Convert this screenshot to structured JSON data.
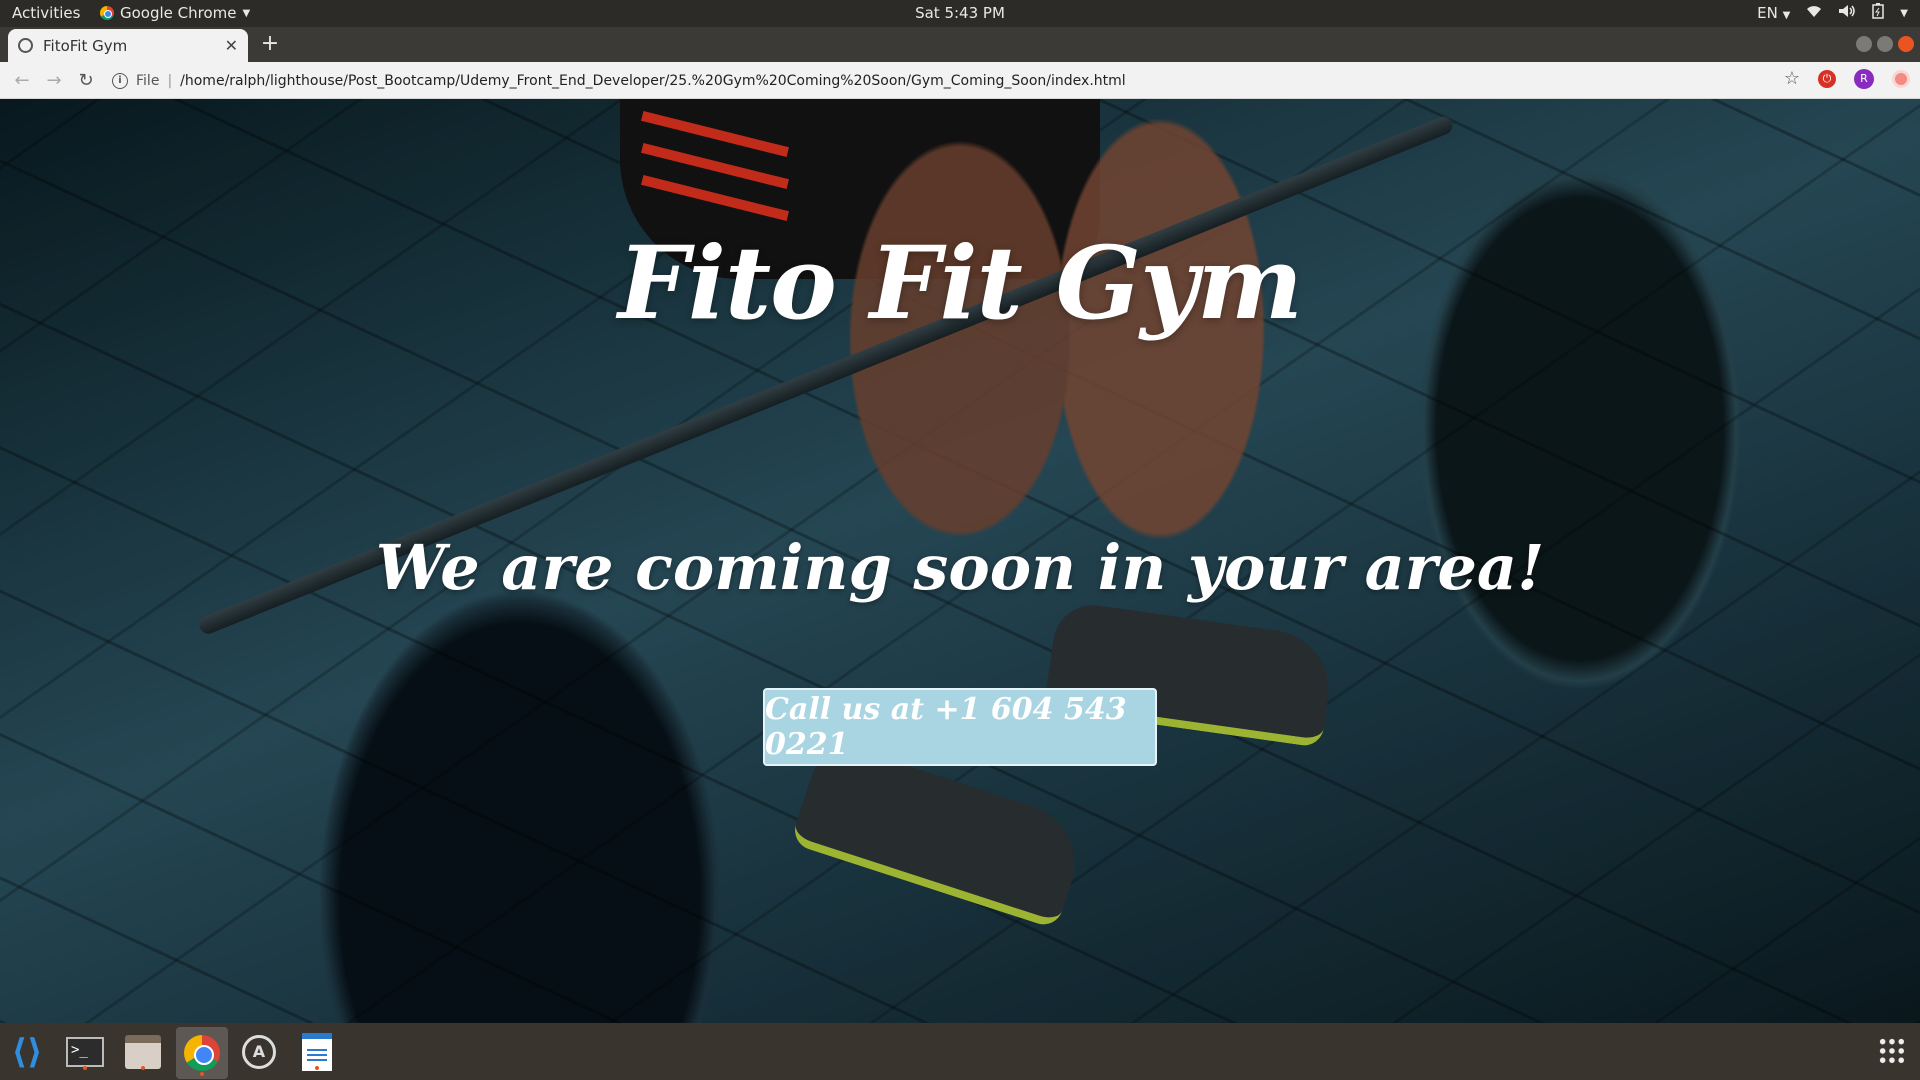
{
  "topbar": {
    "activities": "Activities",
    "app_menu": "Google Chrome",
    "clock": "Sat  5:43 PM",
    "lang": "EN"
  },
  "tabs": [
    {
      "title": "FitoFit Gym"
    }
  ],
  "address": {
    "scheme": "File",
    "url": "/home/ralph/lighthouse/Post_Bootcamp/Udemy_Front_End_Developer/25.%20Gym%20Coming%20Soon/Gym_Coming_Soon/index.html"
  },
  "profile": {
    "initial": "R"
  },
  "page": {
    "title": "Fito Fit Gym",
    "subtitle": "We are coming soon in your area!",
    "cta": "Call us at +1 604 543 0221"
  },
  "dock": {
    "items": [
      "vscode-icon",
      "terminal-icon",
      "files-icon",
      "chrome-icon",
      "software-updater-icon",
      "text-editor-icon"
    ],
    "terminal_glyph": ">_"
  },
  "colors": {
    "cta_bg": "#a9d5e3",
    "ubuntu_orange": "#e95420"
  }
}
